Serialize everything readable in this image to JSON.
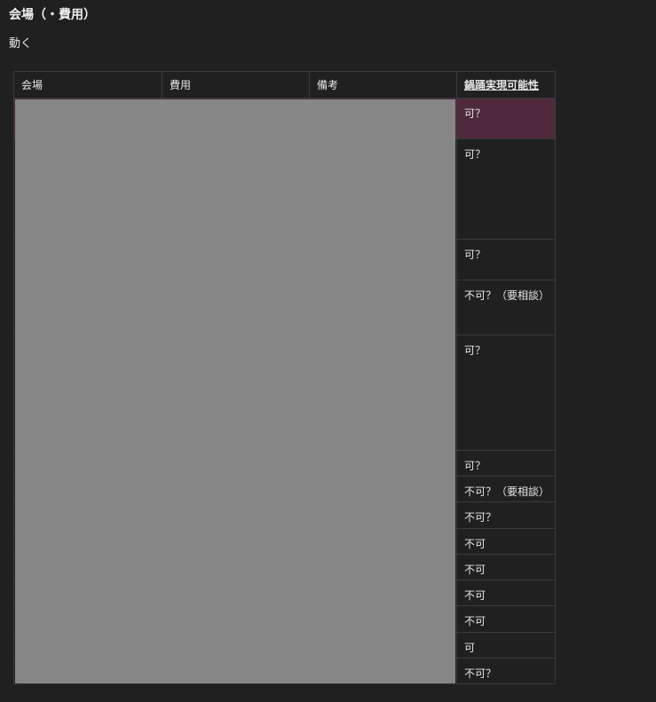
{
  "page": {
    "title": "会場（・費用）",
    "subtitle": "動く"
  },
  "table": {
    "columns": [
      "会場",
      "費用",
      "備考",
      "鍋踊実現可能性"
    ],
    "rows": [
      {
        "possibility": "可？"
      },
      {
        "possibility": "可？"
      },
      {
        "possibility": "可？"
      },
      {
        "possibility": "不可？（要相談）"
      },
      {
        "possibility": "可？"
      },
      {
        "possibility": "可？"
      },
      {
        "possibility": "不可？（要相談）"
      },
      {
        "possibility": "不可？"
      },
      {
        "possibility": "不可"
      },
      {
        "possibility": "不可"
      },
      {
        "possibility": "不可"
      },
      {
        "possibility": "不可"
      },
      {
        "possibility": "可"
      },
      {
        "possibility": "不可？"
      }
    ],
    "highlighted_row_index": 0
  }
}
